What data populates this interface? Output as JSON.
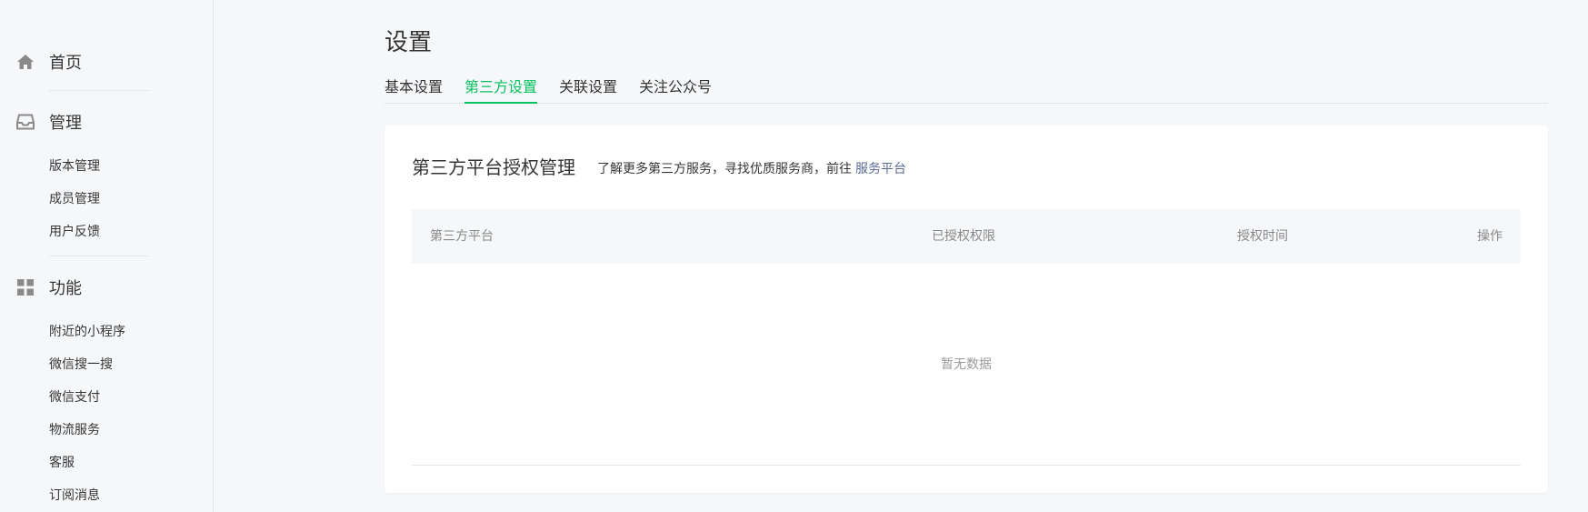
{
  "sidebar": {
    "home": {
      "label": "首页",
      "icon": "home-icon"
    },
    "manage": {
      "label": "管理",
      "icon": "inbox-icon",
      "items": [
        "版本管理",
        "成员管理",
        "用户反馈"
      ]
    },
    "features": {
      "label": "功能",
      "icon": "grid-icon",
      "items": [
        "附近的小程序",
        "微信搜一搜",
        "微信支付",
        "物流服务",
        "客服",
        "订阅消息"
      ]
    }
  },
  "main": {
    "title": "设置",
    "tabs": [
      {
        "label": "基本设置",
        "active": false
      },
      {
        "label": "第三方设置",
        "active": true
      },
      {
        "label": "关联设置",
        "active": false
      },
      {
        "label": "关注公众号",
        "active": false
      }
    ],
    "card": {
      "title": "第三方平台授权管理",
      "description": "了解更多第三方服务，寻找优质服务商，前往",
      "link_label": "服务平台",
      "table": {
        "columns": [
          "第三方平台",
          "已授权权限",
          "授权时间",
          "操作"
        ],
        "rows": [],
        "empty_text": "暂无数据"
      }
    }
  },
  "colors": {
    "accent": "#07c160",
    "link": "#576b95",
    "background": "#f6f7f9"
  }
}
